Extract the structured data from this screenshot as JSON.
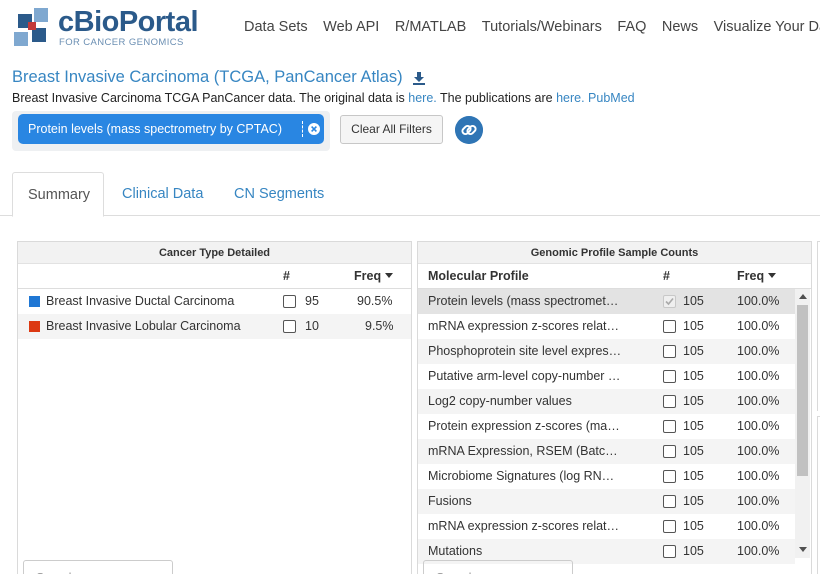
{
  "brand": {
    "name": "cBioPortal",
    "tagline": "FOR CANCER GENOMICS",
    "colors": {
      "primary": "#2b5a8a",
      "accent": "#3786c2",
      "pill": "#2986e2"
    }
  },
  "nav": [
    "Data Sets",
    "Web API",
    "R/MATLAB",
    "Tutorials/Webinars",
    "FAQ",
    "News",
    "Visualize Your Data"
  ],
  "study": {
    "title": "Breast Invasive Carcinoma (TCGA, PanCancer Atlas)",
    "download_icon": "download-icon",
    "desc_prefix": "Breast Invasive Carcinoma TCGA PanCancer data. The original data is ",
    "desc_link1": "here.",
    "desc_mid": " The publications are ",
    "desc_link2": "here.",
    "desc_link3": "PubMed"
  },
  "filters": {
    "active_filter": "Protein levels (mass spectrometry by CPTAC)",
    "clear_label": "Clear All Filters",
    "share_icon": "link-icon"
  },
  "tabs": [
    {
      "label": "Summary",
      "active": true
    },
    {
      "label": "Clinical Data",
      "active": false
    },
    {
      "label": "CN Segments",
      "active": false
    }
  ],
  "cancer_type_panel": {
    "title": "Cancer Type Detailed",
    "col_count": "#",
    "col_freq": "Freq",
    "rows": [
      {
        "color": "#1f77d4",
        "label": "Breast Invasive Ductal Carcinoma",
        "count": "95",
        "freq": "90.5%"
      },
      {
        "color": "#dc3912",
        "label": "Breast Invasive Lobular Carcinoma",
        "count": "10",
        "freq": "9.5%"
      }
    ],
    "search_placeholder": "Search..."
  },
  "genomic_panel": {
    "title": "Genomic Profile Sample Counts",
    "col_profile": "Molecular Profile",
    "col_count": "#",
    "col_freq": "Freq",
    "rows": [
      {
        "label": "Protein levels (mass spectromet…",
        "count": "105",
        "freq": "100.0%",
        "checked": true
      },
      {
        "label": "mRNA expression z-scores relat…",
        "count": "105",
        "freq": "100.0%",
        "checked": false
      },
      {
        "label": "Phosphoprotein site level expres…",
        "count": "105",
        "freq": "100.0%",
        "checked": false
      },
      {
        "label": "Putative arm-level copy-number …",
        "count": "105",
        "freq": "100.0%",
        "checked": false
      },
      {
        "label": "Log2 copy-number values",
        "count": "105",
        "freq": "100.0%",
        "checked": false
      },
      {
        "label": "Protein expression z-scores (ma…",
        "count": "105",
        "freq": "100.0%",
        "checked": false
      },
      {
        "label": "mRNA Expression, RSEM (Batc…",
        "count": "105",
        "freq": "100.0%",
        "checked": false
      },
      {
        "label": "Microbiome Signatures (log RN…",
        "count": "105",
        "freq": "100.0%",
        "checked": false
      },
      {
        "label": "Fusions",
        "count": "105",
        "freq": "100.0%",
        "checked": false
      },
      {
        "label": "mRNA expression z-scores relat…",
        "count": "105",
        "freq": "100.0%",
        "checked": false
      },
      {
        "label": "Mutations",
        "count": "105",
        "freq": "100.0%",
        "checked": false
      }
    ],
    "search_placeholder": "Search..."
  }
}
